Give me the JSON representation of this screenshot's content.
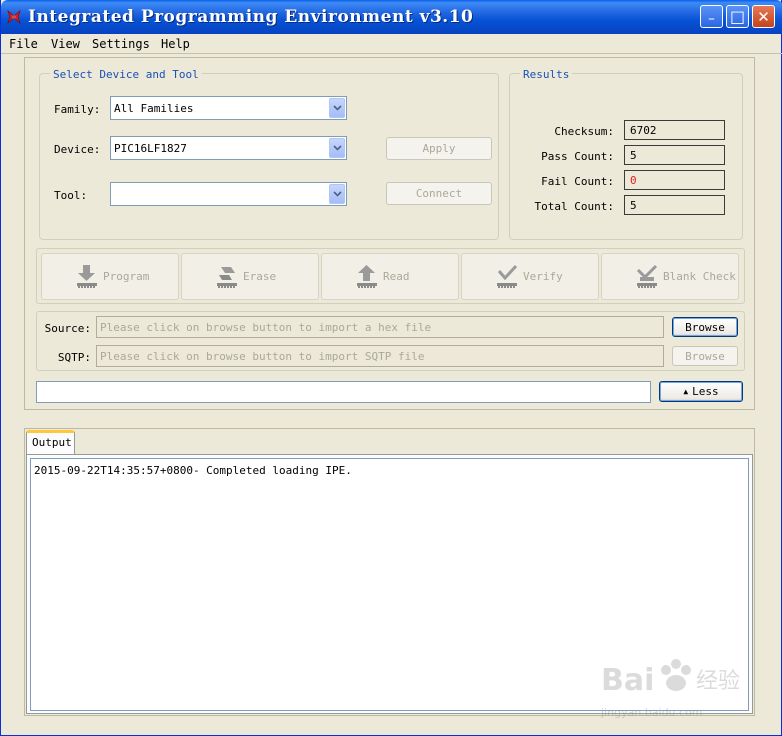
{
  "window": {
    "title": "Integrated Programming Environment v3.10",
    "minimize": "_",
    "maximize": "□",
    "close": "✕"
  },
  "menu": [
    "File",
    "View",
    "Settings",
    "Help"
  ],
  "select_group": {
    "title": "Select Device and Tool",
    "family_label": "Family:",
    "family_value": "All Families",
    "device_label": "Device:",
    "device_value": "PIC16LF1827",
    "tool_label": "Tool:",
    "tool_value": "",
    "apply": "Apply",
    "connect": "Connect"
  },
  "results": {
    "title": "Results",
    "checksum_label": "Checksum:",
    "checksum": "6702",
    "pass_label": "Pass Count:",
    "pass": "5",
    "fail_label": "Fail Count:",
    "fail": "0",
    "total_label": "Total Count:",
    "total": "5",
    "fail_color": "#e02020"
  },
  "actions": {
    "program": "Program",
    "erase": "Erase",
    "read": "Read",
    "verify": "Verify",
    "blank_check": "Blank Check"
  },
  "source": {
    "source_label": "Source:",
    "source_placeholder": "Please click on browse button to import a hex file",
    "browse": "Browse",
    "sqtp_label": "SQTP:",
    "sqtp_placeholder": "Please click on browse button to import SQTP file",
    "browse2": "Browse"
  },
  "status_text": "",
  "less_button": "Less",
  "output": {
    "tab": "Output",
    "log": "2015-09-22T14:35:57+0800- Completed loading IPE."
  },
  "watermark": {
    "text": "jingyan.baidu.com",
    "brand": "Bai 经验"
  }
}
